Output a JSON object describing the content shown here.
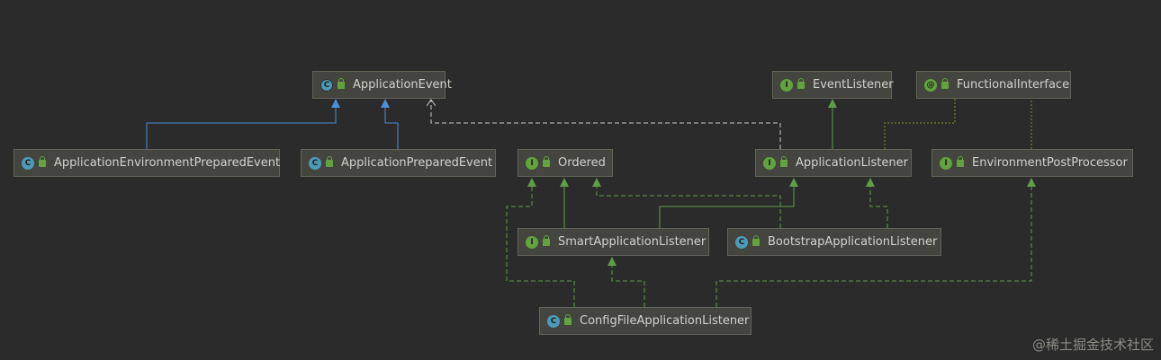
{
  "nodes": [
    {
      "id": "application-event",
      "label": "ApplicationEvent",
      "kind": "class",
      "glyph": "C"
    },
    {
      "id": "event-listener",
      "label": "EventListener",
      "kind": "iface",
      "glyph": "I"
    },
    {
      "id": "functional-interface",
      "label": "FunctionalInterface",
      "kind": "anno",
      "glyph": "@"
    },
    {
      "id": "app-env-prepared-event",
      "label": "ApplicationEnvironmentPreparedEvent",
      "kind": "class",
      "glyph": "C"
    },
    {
      "id": "app-prepared-event",
      "label": "ApplicationPreparedEvent",
      "kind": "class",
      "glyph": "C"
    },
    {
      "id": "ordered",
      "label": "Ordered",
      "kind": "iface",
      "glyph": "I"
    },
    {
      "id": "application-listener",
      "label": "ApplicationListener",
      "kind": "iface",
      "glyph": "I"
    },
    {
      "id": "environment-post-processor",
      "label": "EnvironmentPostProcessor",
      "kind": "iface",
      "glyph": "I"
    },
    {
      "id": "smart-application-listener",
      "label": "SmartApplicationListener",
      "kind": "iface",
      "glyph": "I"
    },
    {
      "id": "bootstrap-application-listener",
      "label": "BootstrapApplicationListener",
      "kind": "class",
      "glyph": "C"
    },
    {
      "id": "config-file-application-listener",
      "label": "ConfigFileApplicationListener",
      "kind": "class",
      "glyph": "C"
    }
  ],
  "relations": [
    {
      "from": "app-env-prepared-event",
      "to": "application-event",
      "type": "extends"
    },
    {
      "from": "app-prepared-event",
      "to": "application-event",
      "type": "extends"
    },
    {
      "from": "application-listener",
      "to": "application-event",
      "type": "uses"
    },
    {
      "from": "application-listener",
      "to": "event-listener",
      "type": "extends-interface"
    },
    {
      "from": "application-listener",
      "to": "functional-interface",
      "type": "annotated"
    },
    {
      "from": "environment-post-processor",
      "to": "functional-interface",
      "type": "annotated"
    },
    {
      "from": "smart-application-listener",
      "to": "ordered",
      "type": "extends-interface"
    },
    {
      "from": "smart-application-listener",
      "to": "application-listener",
      "type": "extends-interface"
    },
    {
      "from": "bootstrap-application-listener",
      "to": "ordered",
      "type": "implements"
    },
    {
      "from": "bootstrap-application-listener",
      "to": "application-listener",
      "type": "implements"
    },
    {
      "from": "config-file-application-listener",
      "to": "ordered",
      "type": "implements"
    },
    {
      "from": "config-file-application-listener",
      "to": "smart-application-listener",
      "type": "implements"
    },
    {
      "from": "config-file-application-listener",
      "to": "environment-post-processor",
      "type": "implements"
    }
  ],
  "colors": {
    "background": "#2b2b2b",
    "node_fill": "#44453f",
    "node_border": "#62635a",
    "text": "#d2d2cc",
    "class_extends": "#4d8fd6",
    "interface_relation": "#5f9e48",
    "uses": "#c8c8c8",
    "annotation": "#7a7d2e"
  },
  "watermark": "@稀土掘金技术社区"
}
